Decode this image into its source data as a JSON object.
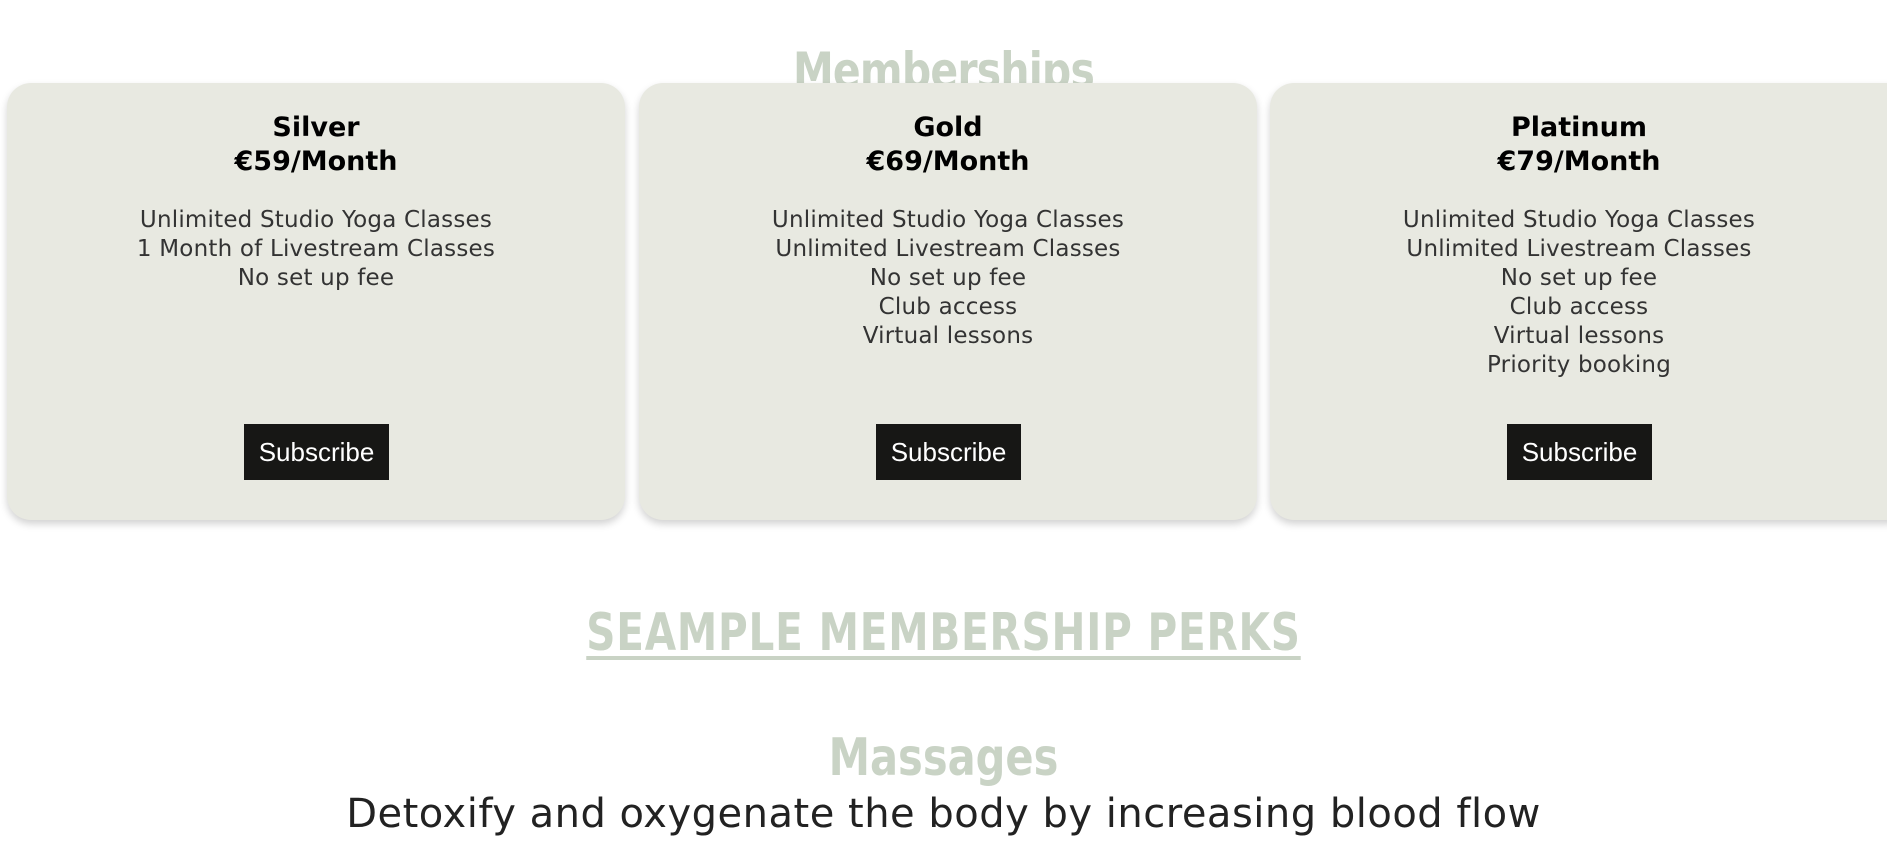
{
  "memberships": {
    "heading": "Memberships",
    "plans": [
      {
        "name": "Silver",
        "price": "€59/Month",
        "features": [
          "Unlimited Studio Yoga Classes",
          "1 Month of Livestream Classes",
          "No set up fee"
        ],
        "button": "Subscribe"
      },
      {
        "name": "Gold",
        "price": "€69/Month",
        "features": [
          "Unlimited Studio Yoga Classes",
          "Unlimited Livestream Classes",
          "No set up fee",
          "Club access",
          "Virtual lessons"
        ],
        "button": "Subscribe"
      },
      {
        "name": "Platinum",
        "price": "€79/Month",
        "features": [
          "Unlimited Studio Yoga Classes",
          "Unlimited Livestream Classes",
          "No set up fee",
          "Club access",
          "Virtual lessons",
          "Priority booking"
        ],
        "button": "Subscribe"
      }
    ]
  },
  "perks": {
    "heading": "SEAMPLE MEMBERSHIP PERKS",
    "items": [
      {
        "title": "Massages",
        "description": "Detoxify and oxygenate the body by increasing blood flow"
      }
    ]
  },
  "colors": {
    "heading_sage": "#c9d3c5",
    "card_background": "#e8e9e1",
    "button_background": "#171715",
    "button_text": "#ffffff"
  }
}
